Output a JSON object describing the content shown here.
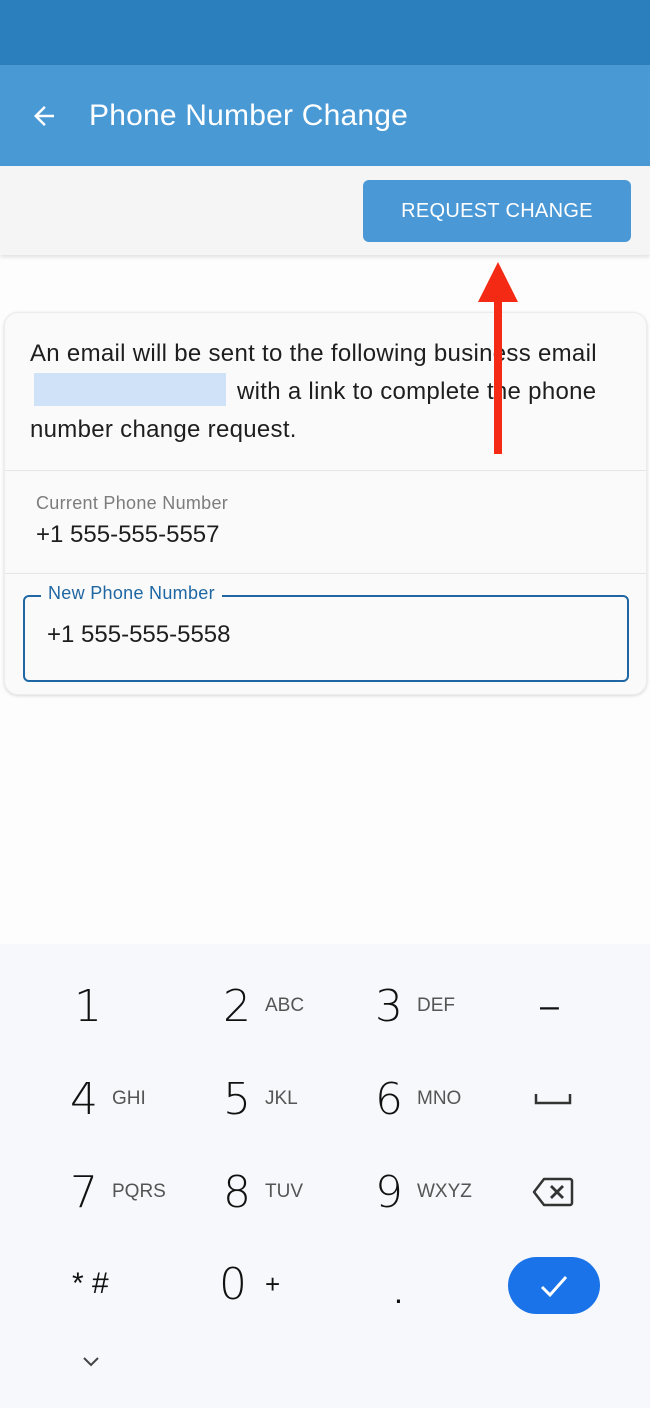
{
  "app_bar": {
    "title": "Phone Number Change",
    "back_icon": "arrow-left-icon"
  },
  "action_bar": {
    "request_change_label": "REQUEST CHANGE"
  },
  "card": {
    "info_text_before": "An email will be sent to the following business email",
    "info_text_after": "with a link to complete the phone number change request.",
    "current_phone_label": "Current Phone Number",
    "current_phone_value": "+1 555-555-5557",
    "new_phone_label": "New Phone Number",
    "new_phone_value": "+1 555-555-5558"
  },
  "annotation": {
    "arrow_color": "#f42a14"
  },
  "keyboard": {
    "keys": [
      {
        "num": "1",
        "letters": ""
      },
      {
        "num": "2",
        "letters": "ABC"
      },
      {
        "num": "3",
        "letters": "DEF"
      },
      {
        "num": "4",
        "letters": "GHI"
      },
      {
        "num": "5",
        "letters": "JKL"
      },
      {
        "num": "6",
        "letters": "MNO"
      },
      {
        "num": "7",
        "letters": "PQRS"
      },
      {
        "num": "8",
        "letters": "TUV"
      },
      {
        "num": "9",
        "letters": "WXYZ"
      },
      {
        "num": "0",
        "letters": "+"
      }
    ],
    "star_hash": "* #",
    "dash": "–",
    "period": ".",
    "space_icon": "space-icon",
    "backspace_icon": "backspace-icon",
    "done_icon": "check-icon",
    "hide_icon": "chevron-down-icon",
    "accent_color": "#1a73e8"
  }
}
